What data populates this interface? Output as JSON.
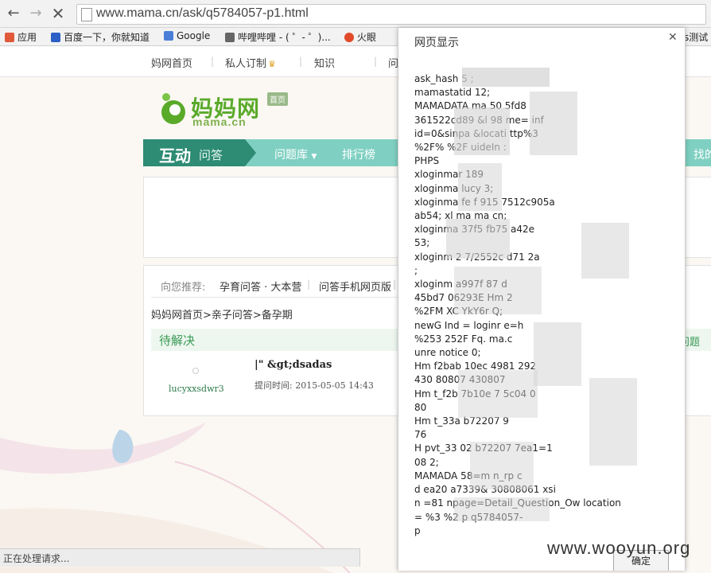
{
  "browser": {
    "url": "www.mama.cn/ask/q5784057-p1.html",
    "back_icon": "arrow-left-icon",
    "forward_icon": "arrow-right-icon",
    "stop_icon": "close-icon"
  },
  "bookmarks": [
    {
      "label": "应用",
      "color": "#e05a3a"
    },
    {
      "label": "百度一下，你就知道",
      "color": "#2a5fc6"
    },
    {
      "label": "Google",
      "color": "#4a7fd8"
    },
    {
      "label": "哔哩哔哩 - ( ゜- ゜)...",
      "color": "#666666"
    },
    {
      "label": "火眼",
      "color": "#e04a2a"
    },
    {
      "label": "s测试",
      "color": "#888888"
    }
  ],
  "site": {
    "top_links": [
      "妈网首页",
      "私人订制",
      "知识",
      "问"
    ],
    "logo_text": "妈妈网",
    "logo_sub": "mama.cn",
    "logo_badge": "首页",
    "nav_primary_big": "互动",
    "nav_primary_small": "问答",
    "nav_items": [
      "问题库",
      "排行榜",
      "找的"
    ],
    "recommend_label": "向您推荐:",
    "recommend_links": [
      "孕育问答 · 大本营",
      "问答手机网页版"
    ],
    "breadcrumb": "妈妈网首页>亲子问答>备孕期",
    "status_label": "待解决",
    "status_right": "问题",
    "question": {
      "username": "lucyxxsdwr3",
      "title": "|\" &gt;dsadas",
      "time_label": "提问时间: 2015-05-05 14:43"
    }
  },
  "dialog": {
    "title": "网页显示",
    "lines": [
      "ask_hash 5 ;",
      "mamastatid 12;",
      "MAMADATA ma 50 5fd8",
      "361522cd89 &l 98 me= inf",
      "id=0&sinpa &locati ttp%3",
      "%2F% %2F uideIn :",
      "PHPS ",
      "xloginmar 189",
      "xloginma lucy 3;",
      "xloginma fe f 915 7512c905a",
      "ab54; xl ma ma cn;",
      "xloginma 37f5 fb75 a42e",
      "53;",
      "xloginm 2 7/2552c d71 2a",
      ";",
      "xloginm a997f 87 d",
      "45bd7 06293E Hm 2",
      "%2FM XC YkY6r Q;",
      "newG Ind = loginr e=h",
      "%253 252F Fq. ma.c",
      "unre notice 0;",
      "Hm f2bab 10ec 4981 292",
      "430 80807 430807",
      "Hm t_f2b 7b10e 7 5c04 0",
      "80",
      "Hm t_33a b72207 9",
      "76",
      "H pvt_33 02 b72207 7ea1=1",
      "08 2;",
      "MAMADA 58=m n_rp c",
      "d ea20 a7339& 30808061 xsi",
      "n =81 npage=Detail_Question_Ow location",
      "= %3 %2 p q5784057-",
      "p "
    ],
    "ok_label": "确定",
    "close_icon": "close-icon"
  },
  "status_text": "正在处理请求...",
  "watermark": "www.wooyun.org"
}
